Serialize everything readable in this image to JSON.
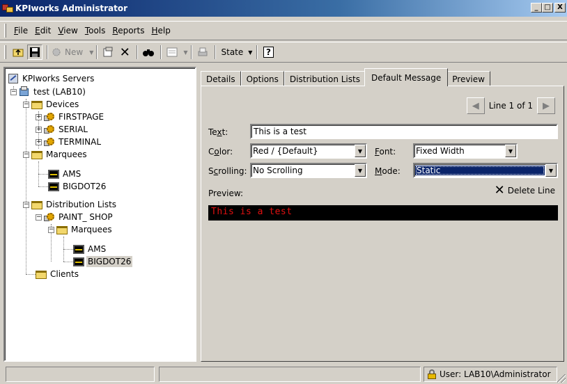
{
  "window": {
    "title": "KPIworks Administrator",
    "min": "_",
    "max": "□",
    "close": "X"
  },
  "menu": [
    {
      "u": "F",
      "rest": "ile"
    },
    {
      "u": "E",
      "rest": "dit"
    },
    {
      "u": "V",
      "rest": "iew"
    },
    {
      "u": "T",
      "rest": "ools"
    },
    {
      "u": "R",
      "rest": "eports"
    },
    {
      "u": "H",
      "rest": "elp"
    }
  ],
  "toolbar": {
    "new_label": "New",
    "state_label": "State",
    "delete_glyph": "✕",
    "find_glyph": "👓",
    "help_glyph": "?"
  },
  "tree": {
    "root": "KPIworks Servers",
    "server": "test (LAB10)",
    "devices": "Devices",
    "device_items": [
      "FIRSTPAGE",
      "SERIAL",
      "TERMINAL"
    ],
    "marquees": "Marquees",
    "marquee_items": [
      "AMS",
      "BIGDOT26"
    ],
    "distribution_lists": "Distribution Lists",
    "paint_shop": "PAINT_ SHOP",
    "dl_marquees": "Marquees",
    "dl_marquee_items": [
      "AMS",
      "BIGDOT26"
    ],
    "clients": "Clients"
  },
  "tabs": [
    "Details",
    "Options",
    "Distribution Lists",
    "Default Message",
    "Preview"
  ],
  "editor": {
    "line_indicator": "Line 1 of 1",
    "text_label": {
      "pre": "Te",
      "u": "x",
      "post": "t:"
    },
    "text_value": "This is a test",
    "color_label": {
      "pre": "C",
      "u": "o",
      "post": "lor:"
    },
    "color_value": "Red / {Default}",
    "font_label": {
      "pre": "",
      "u": "F",
      "post": "ont:"
    },
    "font_value": "Fixed Width",
    "scrolling_label": {
      "pre": "S",
      "u": "c",
      "post": "rolling:"
    },
    "scrolling_value": "No Scrolling",
    "mode_label": {
      "pre": "",
      "u": "M",
      "post": "ode:"
    },
    "mode_value": "Static",
    "preview_label": "Preview:",
    "delete_line": "Delete Line",
    "preview_text": "This is a test",
    "preview_color": "#e01010"
  },
  "status": {
    "user": "User: LAB10\\Administrator"
  }
}
